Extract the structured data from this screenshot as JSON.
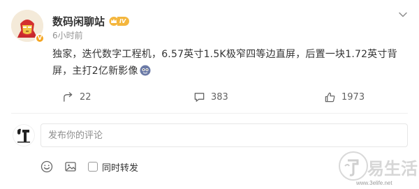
{
  "post": {
    "author": "数码闲聊站",
    "level": "IV",
    "time": "6小时前",
    "text": "独家，迭代数字工程机，6.57英寸1.5K极窄四等边直屏，后置一块1.72英寸背屏，主打2亿新影像"
  },
  "actions": {
    "repost_count": "22",
    "comment_count": "383",
    "like_count": "1973"
  },
  "comment": {
    "placeholder": "发布你的评论",
    "repost_label": "同时转发"
  },
  "watermark": {
    "text": "易生活",
    "site": "www.3elife.net"
  },
  "colors": {
    "accent": "#ff8200",
    "badge": "#f4b63d",
    "muted": "#939393"
  }
}
